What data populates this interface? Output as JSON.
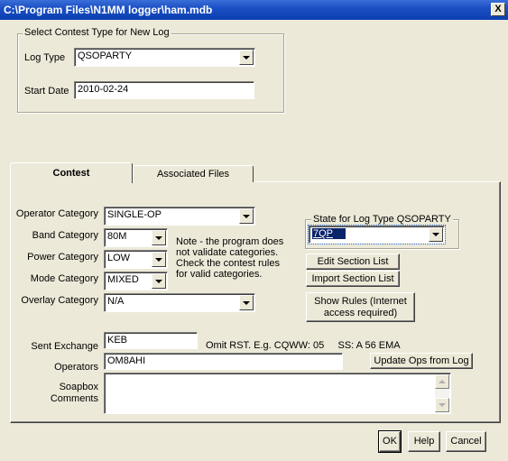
{
  "window": {
    "title": "C:\\Program Files\\N1MM logger\\ham.mdb",
    "close_glyph": "X"
  },
  "new_log": {
    "group_title": "Select Contest Type for New Log",
    "log_type_label": "Log Type",
    "log_type_value": "QSOPARTY",
    "start_date_label": "Start Date",
    "start_date_value": "2010-02-24"
  },
  "tabs": [
    {
      "label": "Contest",
      "active": true
    },
    {
      "label": "Associated Files",
      "active": false
    }
  ],
  "contest": {
    "operator_category": {
      "label": "Operator Category",
      "value": "SINGLE-OP"
    },
    "band_category": {
      "label": "Band Category",
      "value": "80M"
    },
    "power_category": {
      "label": "Power Category",
      "value": "LOW"
    },
    "mode_category": {
      "label": "Mode Category",
      "value": "MIXED"
    },
    "overlay_category": {
      "label": "Overlay Category",
      "value": "N/A"
    },
    "note_lines": [
      "Note -  the program does",
      "not validate categories.",
      "Check the contest rules",
      "for valid categories."
    ],
    "state_group_title": "State for Log Type QSOPARTY",
    "state_value": "7QP",
    "edit_section_list": "Edit Section List",
    "import_section_list": "Import Section List",
    "show_rules_line1": "Show Rules (Internet",
    "show_rules_line2": "access required)",
    "sent_exchange_label": "Sent Exchange",
    "sent_exchange_value": "KEB",
    "sent_exchange_hint": "Omit RST. E.g. CQWW: 05     SS: A 56 EMA",
    "operators_label": "Operators",
    "operators_value": "OM8AHI",
    "update_ops_button": "Update Ops from Log",
    "soapbox_label_line1": "Soapbox",
    "soapbox_label_line2": "Comments",
    "soapbox_value": ""
  },
  "footer": {
    "ok": "OK",
    "help": "Help",
    "cancel": "Cancel"
  },
  "colors": {
    "titlebar": "#0b3fb0",
    "dialog_bg": "#ece9d8",
    "selection": "#0a246a",
    "focus_highlight": "#316ac5"
  }
}
